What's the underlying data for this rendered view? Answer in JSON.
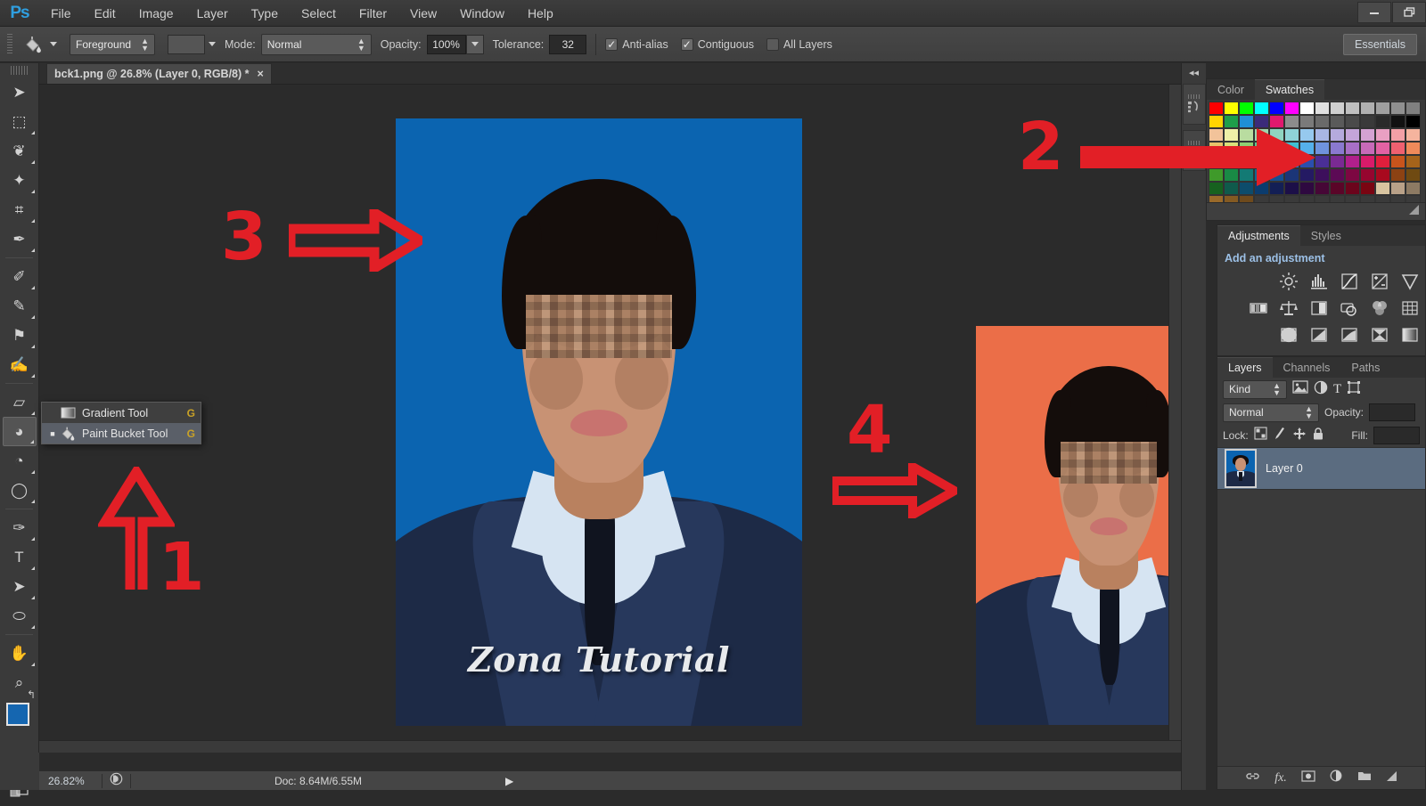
{
  "app": {
    "logo": "Ps",
    "workspace": "Essentials"
  },
  "menubar": {
    "items": [
      "File",
      "Edit",
      "Image",
      "Layer",
      "Type",
      "Select",
      "Filter",
      "View",
      "Window",
      "Help"
    ]
  },
  "window_controls": {
    "minimize": "–",
    "restore": "❐"
  },
  "options_bar": {
    "tool_icon": "paint-bucket-icon",
    "fill_source": "Foreground",
    "mode_label": "Mode:",
    "mode_value": "Normal",
    "opacity_label": "Opacity:",
    "opacity_value": "100%",
    "tolerance_label": "Tolerance:",
    "tolerance_value": "32",
    "checkboxes": [
      {
        "label": "Anti-alias",
        "checked": true
      },
      {
        "label": "Contiguous",
        "checked": true
      },
      {
        "label": "All Layers",
        "checked": false
      }
    ]
  },
  "toolbar": {
    "tools": [
      {
        "name": "move-tool",
        "glyph": "➤",
        "has_corner": false,
        "selected": false
      },
      {
        "name": "rectangular-marquee-tool",
        "glyph": "⬚",
        "has_corner": true,
        "selected": false
      },
      {
        "name": "lasso-tool",
        "glyph": "❦",
        "has_corner": true,
        "selected": false
      },
      {
        "name": "magic-wand-tool",
        "glyph": "✦",
        "has_corner": true,
        "selected": false
      },
      {
        "name": "crop-tool",
        "glyph": "⌗",
        "has_corner": true,
        "selected": false
      },
      {
        "name": "eyedropper-tool",
        "glyph": "✒",
        "has_corner": true,
        "selected": false
      },
      {
        "name": "spot-healing-brush-tool",
        "glyph": "✐",
        "has_corner": true,
        "selected": false
      },
      {
        "name": "brush-tool",
        "glyph": "✎",
        "has_corner": true,
        "selected": false
      },
      {
        "name": "clone-stamp-tool",
        "glyph": "⚑",
        "has_corner": true,
        "selected": false
      },
      {
        "name": "history-brush-tool",
        "glyph": "✍",
        "has_corner": true,
        "selected": false
      },
      {
        "name": "eraser-tool",
        "glyph": "▱",
        "has_corner": true,
        "selected": false
      },
      {
        "name": "paint-bucket-tool",
        "glyph": "◕",
        "has_corner": true,
        "selected": true
      },
      {
        "name": "blur-tool",
        "glyph": "◔",
        "has_corner": true,
        "selected": false
      },
      {
        "name": "dodge-tool",
        "glyph": "◯",
        "has_corner": true,
        "selected": false
      },
      {
        "name": "pen-tool",
        "glyph": "✑",
        "has_corner": true,
        "selected": false
      },
      {
        "name": "horizontal-type-tool",
        "glyph": "T",
        "has_corner": true,
        "selected": false
      },
      {
        "name": "path-selection-tool",
        "glyph": "➤",
        "has_corner": true,
        "selected": false
      },
      {
        "name": "ellipse-tool",
        "glyph": "⬭",
        "has_corner": true,
        "selected": false
      },
      {
        "name": "hand-tool",
        "glyph": "✋",
        "has_corner": true,
        "selected": false
      },
      {
        "name": "zoom-tool",
        "glyph": "⌕",
        "has_corner": false,
        "selected": false
      }
    ],
    "foreground_color": "#1566b0",
    "background_color": "#6cbf3f",
    "quick_mask_icon": "quick-mask-icon",
    "screen_mode_icon": "screen-mode-icon"
  },
  "tool_flyout": {
    "items": [
      {
        "label": "Gradient Tool",
        "shortcut": "G",
        "active": false,
        "icon": "gradient-icon"
      },
      {
        "label": "Paint Bucket Tool",
        "shortcut": "G",
        "active": true,
        "icon": "paint-bucket-icon"
      }
    ]
  },
  "document": {
    "tab_title": "bck1.png @ 26.8% (Layer 0, RGB/8) *",
    "close_glyph": "×",
    "watermark": "Zona Tutorial",
    "photo_a_background": "#0b64b0",
    "photo_b_background": "#eb6e48"
  },
  "annotations": {
    "color": "#e21f26",
    "markers": [
      {
        "number": "1",
        "points_to": "paint-bucket-tool-flyout",
        "direction": "up"
      },
      {
        "number": "2",
        "points_to": "swatches-panel",
        "direction": "right"
      },
      {
        "number": "3",
        "points_to": "blue-photo",
        "direction": "right"
      },
      {
        "number": "4",
        "points_to": "orange-photo",
        "direction": "right"
      }
    ]
  },
  "panels": {
    "dock_collapse_glyph": "◂◂",
    "color_swatches": {
      "tabs": [
        {
          "label": "Color",
          "active": false
        },
        {
          "label": "Swatches",
          "active": true
        }
      ],
      "swatch_rows": [
        [
          "#ff0000",
          "#ffff00",
          "#00ff00",
          "#00ffff",
          "#0000ff",
          "#ff00ff",
          "#ffffff",
          "#e0e0e0",
          "#d0d0d0",
          "#c0c0c0",
          "#b0b0b0",
          "#a0a0a0",
          "#909090",
          "#808080"
        ],
        [
          "#ffd400",
          "#1e9e4a",
          "#1f8fd6",
          "#3b2b7a",
          "#e0186e",
          "#8c8c8c",
          "#7a7a7a",
          "#6a6a6a",
          "#5a5a5a",
          "#4a4a4a",
          "#3a3a3a",
          "#2a2a2a",
          "#111111",
          "#000000"
        ],
        [
          "#f2c39a",
          "#eef0a8",
          "#b9dca0",
          "#9ed6ad",
          "#8fd4c0",
          "#8fd3d8",
          "#96c9ee",
          "#a8b6e4",
          "#b5aadd",
          "#c4a5d9",
          "#d4a2d2",
          "#e9a0c2",
          "#f3a0a6",
          "#f5b49e"
        ],
        [
          "#e8c36b",
          "#d9e07a",
          "#8fcf72",
          "#5ec68e",
          "#45c2b0",
          "#3fc0d2",
          "#55b0ea",
          "#6f93dd",
          "#8a79d0",
          "#a86fc6",
          "#c76ab8",
          "#e262a3",
          "#ef6070",
          "#f08a5a"
        ],
        [
          "#b7d13c",
          "#2fae4e",
          "#1ba07d",
          "#12a3ae",
          "#1598d8",
          "#1f74c8",
          "#2b4fae",
          "#4a2f96",
          "#7a2a93",
          "#b0208c",
          "#d81b6a",
          "#e01f3c",
          "#c8541c",
          "#a5631a"
        ],
        [
          "#3f9a2a",
          "#198a45",
          "#137a74",
          "#11688f",
          "#174f92",
          "#1b3577",
          "#241a63",
          "#3d0f5c",
          "#5c0a55",
          "#7d0742",
          "#96052f",
          "#a8091e",
          "#8c4213",
          "#6f4a12"
        ],
        [
          "#17611f",
          "#0f5a4b",
          "#0d4c6b",
          "#0b3c6e",
          "#131f55",
          "#1c0f48",
          "#2e0940",
          "#460736",
          "#5a0528",
          "#6b041c",
          "#7a0512",
          "#d8c4a0",
          "#b9a188",
          "#8d7a63"
        ],
        [
          "#9a6a2a",
          "#845a22",
          "#6e4a1c",
          "#3a3a3a",
          "#3a3a3a",
          "#3a3a3a",
          "#3a3a3a",
          "#3a3a3a",
          "#3a3a3a",
          "#3a3a3a",
          "#3a3a3a",
          "#3a3a3a",
          "#3a3a3a",
          "#3a3a3a"
        ]
      ]
    },
    "adjustments": {
      "tabs": [
        {
          "label": "Adjustments",
          "active": true
        },
        {
          "label": "Styles",
          "active": false
        }
      ],
      "title": "Add an adjustment",
      "icon_rows": [
        [
          "brightness-contrast-icon",
          "levels-icon",
          "curves-icon",
          "exposure-icon",
          "vibrance-icon"
        ],
        [
          "hue-saturation-icon",
          "color-balance-icon",
          "black-white-icon",
          "photo-filter-icon",
          "channel-mixer-icon",
          "posterize-icon"
        ],
        [
          "invert-icon",
          "threshold-icon",
          "gradient-map-icon",
          "selective-color-icon",
          "gradient-fill-icon"
        ]
      ]
    },
    "layers": {
      "tabs": [
        {
          "label": "Layers",
          "active": true
        },
        {
          "label": "Channels",
          "active": false
        },
        {
          "label": "Paths",
          "active": false
        }
      ],
      "filter_kind": "Kind",
      "filter_icons": [
        "pixel-filter-icon",
        "adjustment-filter-icon",
        "type-filter-icon",
        "shape-filter-icon",
        "smart-object-filter-icon"
      ],
      "blend_mode": "Normal",
      "opacity_label": "Opacity:",
      "lock_label": "Lock:",
      "fill_label": "Fill:",
      "lock_icons": [
        "lock-transparent-pixels-icon",
        "lock-image-pixels-icon",
        "lock-position-icon",
        "lock-all-icon"
      ],
      "items": [
        {
          "name": "Layer 0",
          "selected": true,
          "thumbnail": "blue-portrait-thumbnail"
        }
      ],
      "footer_icons": [
        "link-layers-icon",
        "layer-style-fx-icon",
        "add-layer-mask-icon",
        "new-adjustment-layer-icon",
        "new-group-icon",
        "new-layer-icon",
        "delete-layer-icon"
      ]
    }
  },
  "status_bar": {
    "zoom": "26.82%",
    "doc_info": "Doc: 8.64M/6.55M",
    "play_glyph": "▶",
    "icon": "document-sizes-icon"
  }
}
